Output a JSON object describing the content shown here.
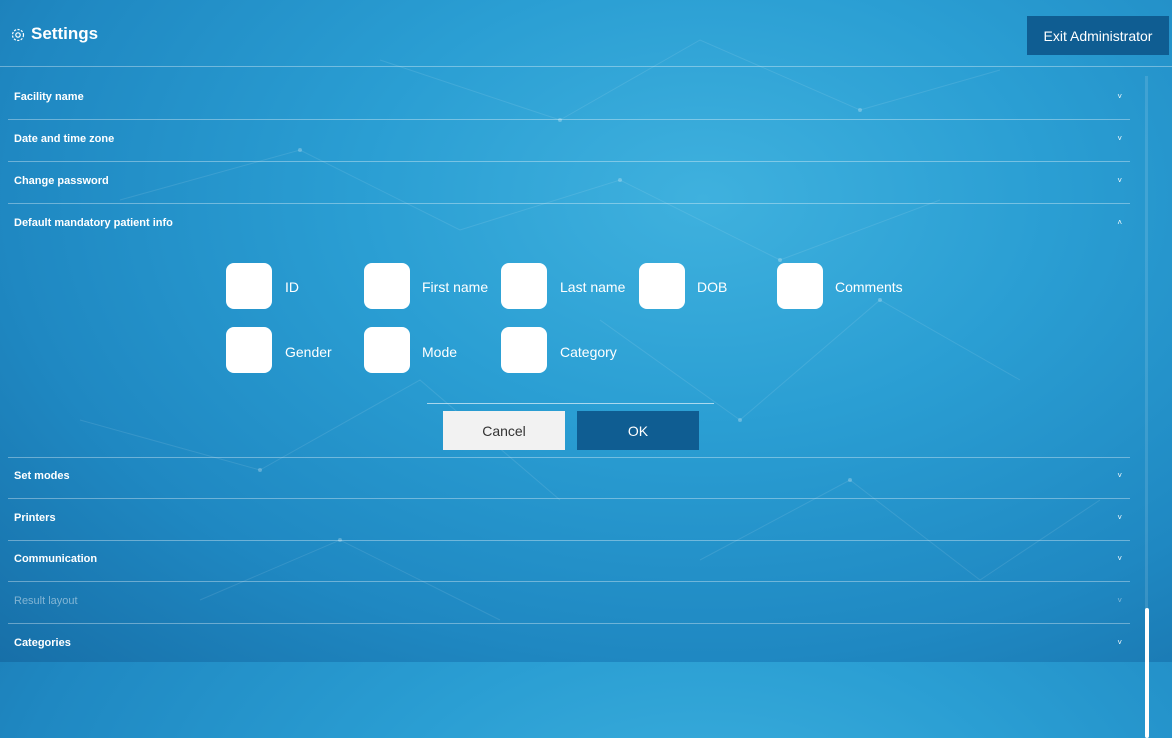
{
  "header": {
    "title": "Settings",
    "exit_label": "Exit Administrator"
  },
  "sections": [
    {
      "label": "Facility name",
      "chevron": "˅"
    },
    {
      "label": "Date and time zone",
      "chevron": "˅"
    },
    {
      "label": "Change password",
      "chevron": "˅"
    },
    {
      "label": "Default mandatory patient info",
      "chevron": "˄"
    },
    {
      "label": "Set modes",
      "chevron": "˅"
    },
    {
      "label": "Printers",
      "chevron": "˅"
    },
    {
      "label": "Communication",
      "chevron": "˅"
    },
    {
      "label": "Result layout",
      "chevron": "˅",
      "disabled": true
    },
    {
      "label": "Categories",
      "chevron": "˅"
    }
  ],
  "mandatory_info": {
    "options": [
      {
        "label": "ID",
        "checked": false
      },
      {
        "label": "First name",
        "checked": false
      },
      {
        "label": "Last name",
        "checked": false
      },
      {
        "label": "DOB",
        "checked": false
      },
      {
        "label": "Comments",
        "checked": false
      },
      {
        "label": "Gender",
        "checked": false
      },
      {
        "label": "Mode",
        "checked": false
      },
      {
        "label": "Category",
        "checked": false
      }
    ],
    "cancel_label": "Cancel",
    "ok_label": "OK"
  },
  "colors": {
    "accent": "#0f5d92",
    "background": "#2a9ed3"
  },
  "icons": {
    "settings": "gear-icon",
    "expand": "chevron-down-icon",
    "collapse": "chevron-up-icon"
  }
}
